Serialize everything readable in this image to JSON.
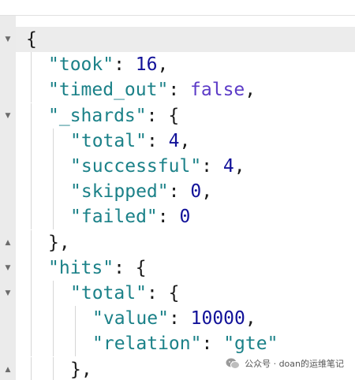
{
  "json_viewer": {
    "lines": [
      {
        "fold": "open",
        "tokens": [
          {
            "t": "p",
            "v": "{"
          }
        ]
      },
      {
        "fold": "",
        "tokens": [
          {
            "t": "k",
            "v": "\"took\""
          },
          {
            "t": "p",
            "v": ": "
          },
          {
            "t": "n",
            "v": "16"
          },
          {
            "t": "p",
            "v": ","
          }
        ]
      },
      {
        "fold": "",
        "tokens": [
          {
            "t": "k",
            "v": "\"timed_out\""
          },
          {
            "t": "p",
            "v": ": "
          },
          {
            "t": "b",
            "v": "false"
          },
          {
            "t": "p",
            "v": ","
          }
        ]
      },
      {
        "fold": "open",
        "tokens": [
          {
            "t": "k",
            "v": "\"_shards\""
          },
          {
            "t": "p",
            "v": ": {"
          }
        ]
      },
      {
        "fold": "",
        "tokens": [
          {
            "t": "k",
            "v": "\"total\""
          },
          {
            "t": "p",
            "v": ": "
          },
          {
            "t": "n",
            "v": "4"
          },
          {
            "t": "p",
            "v": ","
          }
        ]
      },
      {
        "fold": "",
        "tokens": [
          {
            "t": "k",
            "v": "\"successful\""
          },
          {
            "t": "p",
            "v": ": "
          },
          {
            "t": "n",
            "v": "4"
          },
          {
            "t": "p",
            "v": ","
          }
        ]
      },
      {
        "fold": "",
        "tokens": [
          {
            "t": "k",
            "v": "\"skipped\""
          },
          {
            "t": "p",
            "v": ": "
          },
          {
            "t": "n",
            "v": "0"
          },
          {
            "t": "p",
            "v": ","
          }
        ]
      },
      {
        "fold": "",
        "tokens": [
          {
            "t": "k",
            "v": "\"failed\""
          },
          {
            "t": "p",
            "v": ": "
          },
          {
            "t": "n",
            "v": "0"
          }
        ]
      },
      {
        "fold": "close",
        "tokens": [
          {
            "t": "p",
            "v": "},"
          }
        ]
      },
      {
        "fold": "open",
        "tokens": [
          {
            "t": "k",
            "v": "\"hits\""
          },
          {
            "t": "p",
            "v": ": {"
          }
        ]
      },
      {
        "fold": "open",
        "tokens": [
          {
            "t": "k",
            "v": "\"total\""
          },
          {
            "t": "p",
            "v": ": {"
          }
        ]
      },
      {
        "fold": "",
        "tokens": [
          {
            "t": "k",
            "v": "\"value\""
          },
          {
            "t": "p",
            "v": ": "
          },
          {
            "t": "n",
            "v": "10000"
          },
          {
            "t": "p",
            "v": ","
          }
        ]
      },
      {
        "fold": "",
        "tokens": [
          {
            "t": "k",
            "v": "\"relation\""
          },
          {
            "t": "p",
            "v": ": "
          },
          {
            "t": "s",
            "v": "\"gte\""
          }
        ]
      },
      {
        "fold": "close",
        "tokens": [
          {
            "t": "p",
            "v": "},"
          }
        ]
      }
    ]
  },
  "watermark": {
    "icon": "wechat-icon",
    "text": "公众号 · doan的运维笔记"
  },
  "colors": {
    "key": "#1b8188",
    "string": "#1b8188",
    "number": "#111199",
    "boolean": "#5c3bc7",
    "punctuation": "#1a1a1a"
  }
}
